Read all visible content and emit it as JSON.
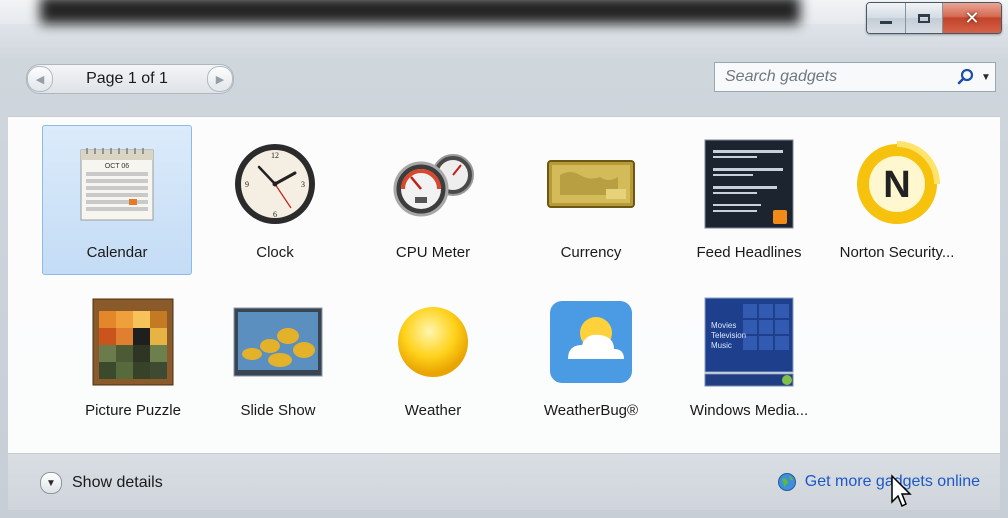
{
  "window": {
    "controls": {
      "minimize_icon": "minimize-icon",
      "maximize_icon": "maximize-icon",
      "close_icon": "close-icon"
    }
  },
  "toolbar": {
    "page_label": "Page 1 of 1",
    "search_placeholder": "Search gadgets"
  },
  "gadgets": [
    {
      "label": "Calendar",
      "icon": "calendar-icon",
      "selected": true
    },
    {
      "label": "Clock",
      "icon": "clock-icon",
      "selected": false
    },
    {
      "label": "CPU Meter",
      "icon": "cpu-meter-icon",
      "selected": false
    },
    {
      "label": "Currency",
      "icon": "currency-icon",
      "selected": false
    },
    {
      "label": "Feed Headlines",
      "icon": "feed-headlines-icon",
      "selected": false
    },
    {
      "label": "Norton Security...",
      "icon": "norton-icon",
      "selected": false
    },
    {
      "label": "Picture Puzzle",
      "icon": "picture-puzzle-icon",
      "selected": false
    },
    {
      "label": "Slide Show",
      "icon": "slide-show-icon",
      "selected": false
    },
    {
      "label": "Weather",
      "icon": "weather-icon",
      "selected": false
    },
    {
      "label": "WeatherBug®",
      "icon": "weatherbug-icon",
      "selected": false
    },
    {
      "label": "Windows Media...",
      "icon": "windows-media-icon",
      "selected": false
    }
  ],
  "calendar_art": {
    "month": "OCT 06"
  },
  "media_art": {
    "lines": [
      "Movies",
      "Television",
      "Music"
    ]
  },
  "footer": {
    "details_label": "Show details",
    "more_label": "Get more gadgets online"
  },
  "colors": {
    "link": "#1d58c7",
    "selection": "#c4dcf5"
  }
}
